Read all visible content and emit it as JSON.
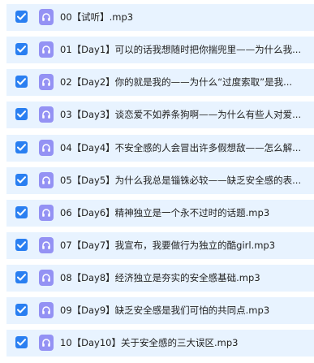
{
  "files": [
    {
      "name": "00【试听】.mp3",
      "checked": true,
      "icon": "headphones-icon"
    },
    {
      "name": "01【Day1】可以的话我想随时把你揣兜里——为什么我...",
      "checked": true,
      "icon": "headphones-icon"
    },
    {
      "name": "02【Day2】你的就是我的——为什么“过度索取”是我...",
      "checked": true,
      "icon": "headphones-icon"
    },
    {
      "name": "03【Day3】谈恋爱不如养条狗啊——为什么有些人对爱...",
      "checked": true,
      "icon": "headphones-icon"
    },
    {
      "name": "04【Day4】不安全感的人会冒出许多假想敌——怎么解...",
      "checked": true,
      "icon": "headphones-icon"
    },
    {
      "name": "05【Day5】为什么我总是锱铢必较——缺乏安全感的表...",
      "checked": true,
      "icon": "headphones-icon"
    },
    {
      "name": "06【Day6】精神独立是一个永不过时的话题.mp3",
      "checked": true,
      "icon": "headphones-icon"
    },
    {
      "name": "07【Day7】我宣布，我要做行为独立的酷girl.mp3",
      "checked": true,
      "icon": "headphones-icon"
    },
    {
      "name": "08【Day8】经济独立是夯实的安全感基础.mp3",
      "checked": true,
      "icon": "headphones-icon"
    },
    {
      "name": "09【Day9】缺乏安全感是我们可怕的共同点.mp3",
      "checked": true,
      "icon": "headphones-icon"
    },
    {
      "name": "10【Day10】关于安全感的三大误区.mp3",
      "checked": true,
      "icon": "headphones-icon"
    }
  ],
  "colors": {
    "row_background": "#e8f3ff",
    "checkbox": "#2a7ff1",
    "file_icon": "#9492f4"
  }
}
